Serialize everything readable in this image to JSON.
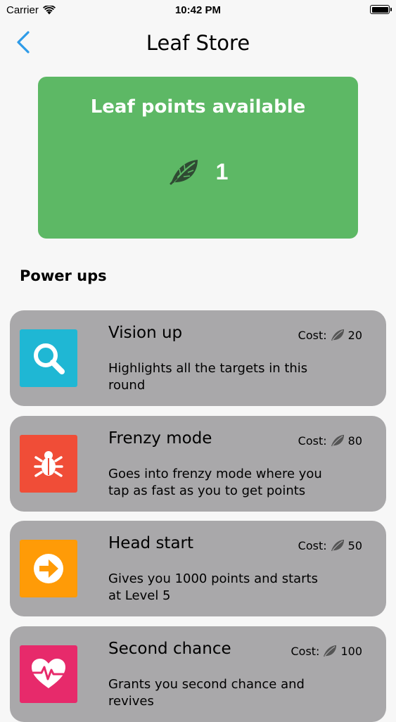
{
  "status_bar": {
    "carrier": "Carrier",
    "time": "10:42 PM"
  },
  "nav": {
    "title": "Leaf Store"
  },
  "points_card": {
    "title": "Leaf points available",
    "value": "1"
  },
  "section": {
    "title": "Power ups"
  },
  "powerups": [
    {
      "name": "Vision up",
      "cost_label": "Cost:",
      "cost": "20",
      "description": "Highlights all the targets in this round",
      "icon": "magnifier-icon",
      "color": "#1fb7d4"
    },
    {
      "name": "Frenzy mode",
      "cost_label": "Cost:",
      "cost": "80",
      "description": "Goes into frenzy mode where you tap as fast as you to get points",
      "icon": "bug-icon",
      "color": "#f04d37"
    },
    {
      "name": "Head start",
      "cost_label": "Cost:",
      "cost": "50",
      "description": "Gives you 1000 points and starts at Level 5",
      "icon": "arrow-right-icon",
      "color": "#ff9b07"
    },
    {
      "name": "Second chance",
      "cost_label": "Cost:",
      "cost": "100",
      "description": "Grants you second chance and revives",
      "icon": "heartbeat-icon",
      "color": "#e72a6b"
    }
  ],
  "colors": {
    "accent": "#2e9be8",
    "card_green": "#5db865",
    "row_gray": "#a9a8aa"
  }
}
